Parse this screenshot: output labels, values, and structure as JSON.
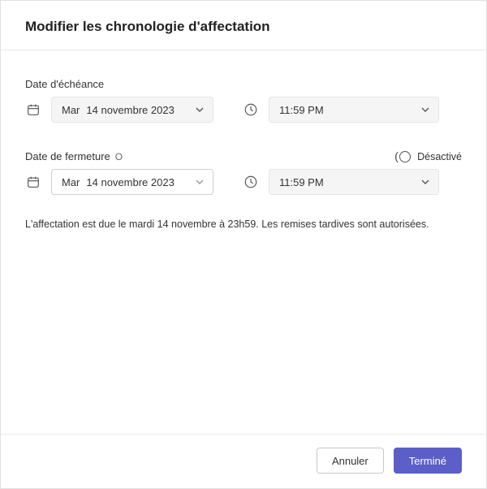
{
  "header": {
    "title": "Modifier les chronologie d'affectation"
  },
  "due": {
    "label": "Date d'échéance",
    "date_prefix": "Mar",
    "date_value": "14 novembre 2023",
    "time_value": "11:59 PM"
  },
  "close": {
    "label": "Date de fermeture",
    "info_glyph": "O",
    "toggle_label": "Désactivé",
    "date_prefix": "Mar",
    "date_value": "14 novembre 2023",
    "time_value": "11:59 PM"
  },
  "description": "L'affectation est due le mardi 14 novembre à 23h59. Les remises tardives sont autorisées.",
  "footer": {
    "cancel": "Annuler",
    "done": "Terminé"
  },
  "icons": {
    "calendar": "calendar-icon",
    "clock": "clock-icon",
    "chevron": "chevron-down-icon",
    "info": "info-icon",
    "toggle": "toggle-off-icon"
  },
  "colors": {
    "primary": "#5b5fc7",
    "border": "#e1e1e1",
    "fill": "#f5f5f5"
  }
}
